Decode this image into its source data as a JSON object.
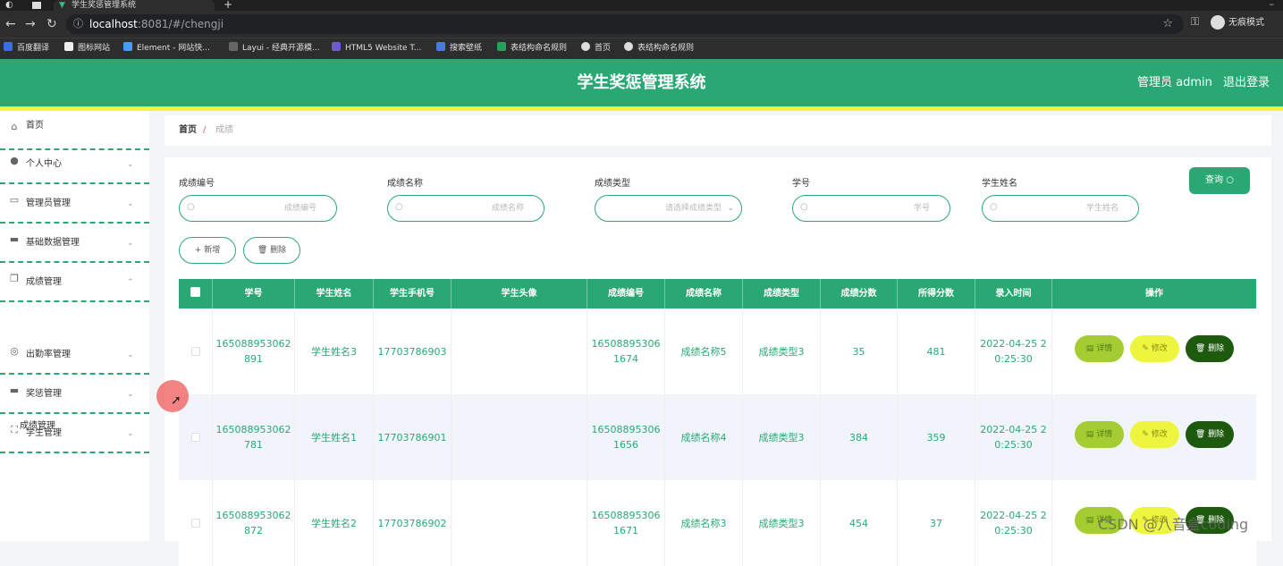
{
  "browser": {
    "tab_title": "学生奖惩管理系统",
    "url_host": "localhost",
    "url_rest": ":8081/#/chengji",
    "profile_label": "无痕模式",
    "bookmarks": [
      "百度翻译",
      "图标网站",
      "Element - 网站快...",
      "Layui - 经典开源模...",
      "HTML5 Website T...",
      "搜索壁纸",
      "表结构命名规则",
      "首页",
      "表结构命名规则"
    ]
  },
  "header": {
    "title": "学生奖惩管理系统",
    "user": "管理员 admin",
    "logout": "退出登录"
  },
  "sidebar": {
    "items": [
      {
        "label": "首页",
        "icon": "home-icon"
      },
      {
        "label": "个人中心",
        "icon": "user-icon"
      },
      {
        "label": "管理员管理",
        "icon": "message-icon"
      },
      {
        "label": "基础数据管理",
        "icon": "chat-icon"
      },
      {
        "label": "成绩管理",
        "icon": "copy-icon"
      },
      {
        "label": "出勤率管理",
        "icon": "dashboard-icon"
      },
      {
        "label": "奖惩管理",
        "icon": "chat-icon"
      },
      {
        "label": "学生管理",
        "icon": "fullscreen-icon"
      }
    ],
    "submenu_label": "成绩管理"
  },
  "breadcrumb": {
    "home": "首页",
    "separator": "/",
    "current": "成绩"
  },
  "filters": {
    "fields": [
      {
        "label": "成绩编号",
        "placeholder": "成绩编号"
      },
      {
        "label": "成绩名称",
        "placeholder": "成绩名称"
      },
      {
        "label": "成绩类型",
        "placeholder": "请选择成绩类型"
      },
      {
        "label": "学号",
        "placeholder": "学号"
      },
      {
        "label": "学生姓名",
        "placeholder": "学生姓名"
      }
    ],
    "query_label": "查询",
    "add_label": "新增",
    "delete_label": "删除"
  },
  "table": {
    "headers": [
      "学号",
      "学生姓名",
      "学生手机号",
      "学生头像",
      "成绩编号",
      "成绩名称",
      "成绩类型",
      "成绩分数",
      "所得分数",
      "录入时间",
      "操作"
    ],
    "rows": [
      {
        "student_no": [
          "165088953062",
          "891"
        ],
        "name": "学生姓名3",
        "phone": "17703786903",
        "code": [
          "16508895306",
          "1674"
        ],
        "title": "成绩名称5",
        "type": "成绩类型3",
        "score": "35",
        "earned": "481",
        "time": [
          "2022-04-25 2",
          "0:25:30"
        ]
      },
      {
        "student_no": [
          "165088953062",
          "781"
        ],
        "name": "学生姓名1",
        "phone": "17703786901",
        "code": [
          "16508895306",
          "1656"
        ],
        "title": "成绩名称4",
        "type": "成绩类型3",
        "score": "384",
        "earned": "359",
        "time": [
          "2022-04-25 2",
          "0:25:30"
        ]
      },
      {
        "student_no": [
          "165088953062",
          "872"
        ],
        "name": "学生姓名2",
        "phone": "17703786902",
        "code": [
          "16508895306",
          "1671"
        ],
        "title": "成绩名称3",
        "type": "成绩类型3",
        "score": "454",
        "earned": "37",
        "time": [
          "2022-04-25 2",
          "0:25:30"
        ]
      }
    ],
    "actions": {
      "detail": "详情",
      "edit": "修改",
      "delete": "删除"
    }
  },
  "watermark": "CSDN @八音盒coding",
  "colors": {
    "primary": "#2aa874",
    "accent_bar": "#f3f53a",
    "detail_btn": "#a4cd34",
    "edit_btn": "#eef53f",
    "delete_btn": "#1d5a0d"
  }
}
